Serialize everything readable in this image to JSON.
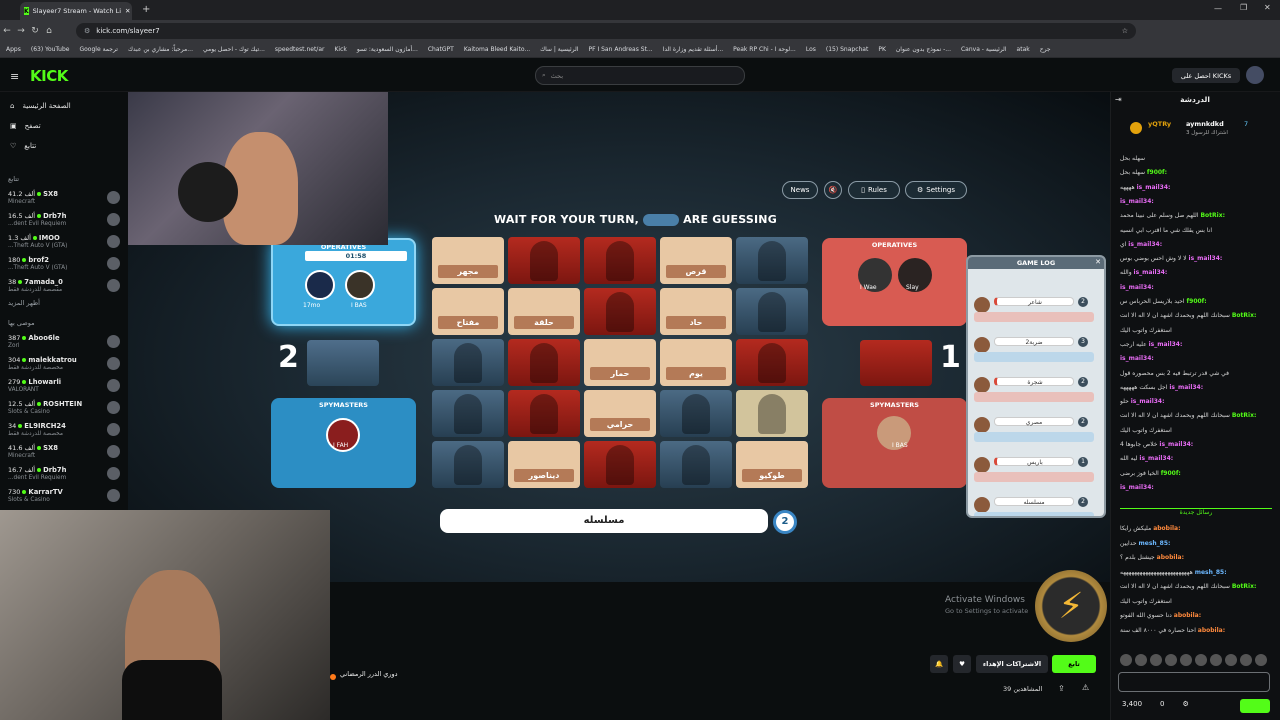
{
  "browser": {
    "tab_title": "Slayeer7 Stream - Watch Li",
    "url": "kick.com/slayeer7",
    "bookmarks": [
      "Apps",
      "(63) YouTube",
      "Google ترجمة",
      "مرحباً: مشاري بن عبدك...",
      "تيك توك - احصل يومي...",
      "speedtest.net/ar",
      "Kick",
      "أمازون السعودية: تسو...",
      "ChatGPT",
      "Kaitoma Bleed Kaito...",
      "الرئيسية | ساك",
      "PF I San Andreas St...",
      "أسئلة تقديم وزارة الدا...",
      "Peak RP Chi - لوحة ا...",
      "Los",
      "(15) Snapchat",
      "PK",
      "نموذج بدون عنوان -...",
      "Canva - الرئيسية",
      "atak",
      "جرح"
    ]
  },
  "header": {
    "logo": "KICK",
    "search_placeholder": "بحث",
    "get_kick": "احصل على KICKs"
  },
  "sidebar": {
    "nav": [
      {
        "label": "الصفحة الرئيسية",
        "icon": "home-icon"
      },
      {
        "label": "تصفح",
        "icon": "browse-icon"
      },
      {
        "label": "تتابع",
        "icon": "heart-icon"
      }
    ],
    "following_head": "تتابع",
    "following": [
      {
        "name": "SX8",
        "cat": "Minecraft",
        "viewers": "41.2 ألف"
      },
      {
        "name": "Drb7h",
        "cat": "...dent Evil Requiem",
        "viewers": "16.5 ألف"
      },
      {
        "name": "IMOO",
        "cat": "...Theft Auto V (GTA)",
        "viewers": "1.3 ألف"
      },
      {
        "name": "brof2",
        "cat": "...Theft Auto V (GTA)",
        "viewers": "180"
      },
      {
        "name": "7amada_0",
        "cat": "مقصصة للدردشة فقط",
        "viewers": "38"
      }
    ],
    "show_more": "أظهر المزيد",
    "rec_head": "موصى بها",
    "recommended": [
      {
        "name": "Aboo6le",
        "cat": "Zorl",
        "viewers": "387"
      },
      {
        "name": "malekkatrou",
        "cat": "مخصصة للدردشة فقط",
        "viewers": "304"
      },
      {
        "name": "Lhowarli",
        "cat": "VALORANT",
        "viewers": "279"
      },
      {
        "name": "ROSHTEIN",
        "cat": "Slots & Casino",
        "viewers": "12.5 ألف"
      },
      {
        "name": "EL9IRCH24",
        "cat": "مخصصة للدردشة فقط",
        "viewers": "34"
      },
      {
        "name": "SX8",
        "cat": "Minecraft",
        "viewers": "41.6 ألف"
      },
      {
        "name": "Drb7h",
        "cat": "...dent Evil Requiem",
        "viewers": "16.7 ألف"
      },
      {
        "name": "KarrarTV",
        "cat": "Slots & Casino",
        "viewers": "730"
      }
    ]
  },
  "game": {
    "buttons": {
      "news": "News",
      "rules": "Rules",
      "settings": "Settings"
    },
    "turn_text": "WAIT FOR YOUR TURN,",
    "turn_suffix": "ARE GUESSING",
    "blue": {
      "ops": "OPERATIVES",
      "timer": "01:58",
      "player1": "17mo",
      "player2": "I BAS",
      "score": "2",
      "spy_label": "SPYMASTERS",
      "spy": "I FAH"
    },
    "red": {
      "ops": "OPERATIVES",
      "player1": "I Wae",
      "player2": "Slay",
      "score": "1",
      "spy_label": "SPYMASTERS",
      "spy": "I BAS"
    },
    "cards": [
      {
        "t": "tan",
        "w": "مجهر"
      },
      {
        "t": "red",
        "w": ""
      },
      {
        "t": "red",
        "w": ""
      },
      {
        "t": "tan",
        "w": "قرص"
      },
      {
        "t": "blue",
        "w": ""
      },
      {
        "t": "tan",
        "w": "مفتاح"
      },
      {
        "t": "tan",
        "w": "حلقة"
      },
      {
        "t": "red",
        "w": ""
      },
      {
        "t": "tan",
        "w": "حاد"
      },
      {
        "t": "blue",
        "w": ""
      },
      {
        "t": "blue",
        "w": ""
      },
      {
        "t": "red",
        "w": ""
      },
      {
        "t": "tan",
        "w": "حمار"
      },
      {
        "t": "tan",
        "w": "يوم"
      },
      {
        "t": "red",
        "w": ""
      },
      {
        "t": "blue",
        "w": ""
      },
      {
        "t": "red",
        "w": ""
      },
      {
        "t": "tan",
        "w": "حرامي"
      },
      {
        "t": "blue",
        "w": ""
      },
      {
        "t": "neu",
        "w": ""
      },
      {
        "t": "blue",
        "w": ""
      },
      {
        "t": "tan",
        "w": "ديناصور"
      },
      {
        "t": "red",
        "w": ""
      },
      {
        "t": "blue",
        "w": ""
      },
      {
        "t": "tan",
        "w": "طوكيو"
      }
    ],
    "clue": "مسلسله",
    "clue_num": "2",
    "log_title": "GAME LOG",
    "log": [
      {
        "w": "شاعر",
        "n": "2",
        "team": "red"
      },
      {
        "w": "ضربة2",
        "n": "3",
        "team": "blue"
      },
      {
        "w": "شجرة",
        "n": "2",
        "team": "red"
      },
      {
        "w": "مصري",
        "n": "2",
        "team": "blue"
      },
      {
        "w": "باريس",
        "n": "1",
        "team": "red"
      },
      {
        "w": "مسلسله",
        "n": "2",
        "team": "blue"
      }
    ]
  },
  "overlay": {
    "activate": "Activate Windows",
    "activate_sub": "Go to Settings to activate"
  },
  "below": {
    "streamer": "دوري الدرر الرمضاني",
    "follow": "تابع",
    "subs": "الاشتراكات الإهداء",
    "viewers": "39 المشاهدين"
  },
  "chat": {
    "title": "الدردشة",
    "pinned_user1": "yQTRy",
    "pinned_user2": "aymnkdkd",
    "pinned_count": "7",
    "pinned_note": "اشتراك للرسول 3",
    "messages": [
      {
        "u": "",
        "m": "سهله بحل",
        "c": "#aaa"
      },
      {
        "u": "f900f:",
        "m": "سهله بحل",
        "c": "#53fc18"
      },
      {
        "u": "is_mail34:",
        "m": "ههههه",
        "c": "#e86cf5"
      },
      {
        "u": "is_mail34:",
        "m": "",
        "c": "#e86cf5"
      },
      {
        "u": "BotRix:",
        "m": "اللهم صل وسلم على نبينا محمد",
        "c": "#53fc18"
      },
      {
        "u": "",
        "m": "انا بس يقلك شي ما اقترب ابي انسيه",
        "c": "#aaa"
      },
      {
        "u": "is_mail34:",
        "m": "اي",
        "c": "#e86cf5"
      },
      {
        "u": "is_mail34:",
        "m": "لا لا وش احس بوضي بوس",
        "c": "#e86cf5"
      },
      {
        "u": "is_mail34:",
        "m": "والله",
        "c": "#e86cf5"
      },
      {
        "u": "is_mail34:",
        "m": "",
        "c": "#e86cf5"
      },
      {
        "u": "f900f:",
        "m": "احيد بلاريسل الحرباس س",
        "c": "#53fc18"
      },
      {
        "u": "BotRix:",
        "m": "سبحانك اللهم وبحمدك اشهد ان لا اله الا انت",
        "c": "#53fc18"
      },
      {
        "u": "",
        "m": "استغفرك واتوب اليك",
        "c": "#aaa"
      },
      {
        "u": "is_mail34:",
        "m": "عليه ارجب",
        "c": "#e86cf5"
      },
      {
        "u": "is_mail34:",
        "m": "",
        "c": "#e86cf5"
      },
      {
        "u": "",
        "m": "في شي قدر ترتبط فيه 2 بس محصوره قول",
        "c": "#aaa"
      },
      {
        "u": "is_mail34:",
        "m": "اجل بسكت هههههه",
        "c": "#e86cf5"
      },
      {
        "u": "is_mail34:",
        "m": "حلو",
        "c": "#e86cf5"
      },
      {
        "u": "BotRix:",
        "m": "سبحانك اللهم وبحمدك اشهد ان لا اله الا انت",
        "c": "#53fc18"
      },
      {
        "u": "",
        "m": "استغفرك واتوب اليك",
        "c": "#aaa"
      },
      {
        "u": "is_mail34:",
        "m": "خلاص جابوها 4",
        "c": "#e86cf5"
      },
      {
        "u": "is_mail34:",
        "m": "ليه الله",
        "c": "#e86cf5"
      },
      {
        "u": "f900f:",
        "m": "الخيا فوز برضى",
        "c": "#53fc18"
      },
      {
        "u": "is_mail34:",
        "m": "",
        "c": "#e86cf5"
      }
    ],
    "new_messages": "رسائل جديدة",
    "messages2": [
      {
        "u": "abobila:",
        "m": "مليكش رايكا",
        "c": "#ff8a3d"
      },
      {
        "u": "mesh_85:",
        "m": "حدايين",
        "c": "#6cb8ff"
      },
      {
        "u": "abobila:",
        "m": "جيشنل بلدم ؟",
        "c": "#ff8a3d"
      },
      {
        "u": "mesh_85:",
        "m": "هههههههههههههههههههههههههه",
        "c": "#6cb8ff"
      },
      {
        "u": "BotRix:",
        "m": "سبحانك اللهم وبحمدك اشهد ان لا اله الا انت",
        "c": "#53fc18"
      },
      {
        "u": "",
        "m": "استغفرك واتوب اليك",
        "c": "#aaa"
      },
      {
        "u": "abobila:",
        "m": "دنا حسوي الله الفوتو",
        "c": "#ff8a3d"
      },
      {
        "u": "abobila:",
        "m": "احنا حصاره في ٨٠٠٠ الف سنة",
        "c": "#ff8a3d"
      }
    ],
    "points": "3,400",
    "zero": "0"
  },
  "colors": {
    "accent": "#53fc18",
    "blue": "#3aa8dc",
    "red": "#d85b52"
  }
}
